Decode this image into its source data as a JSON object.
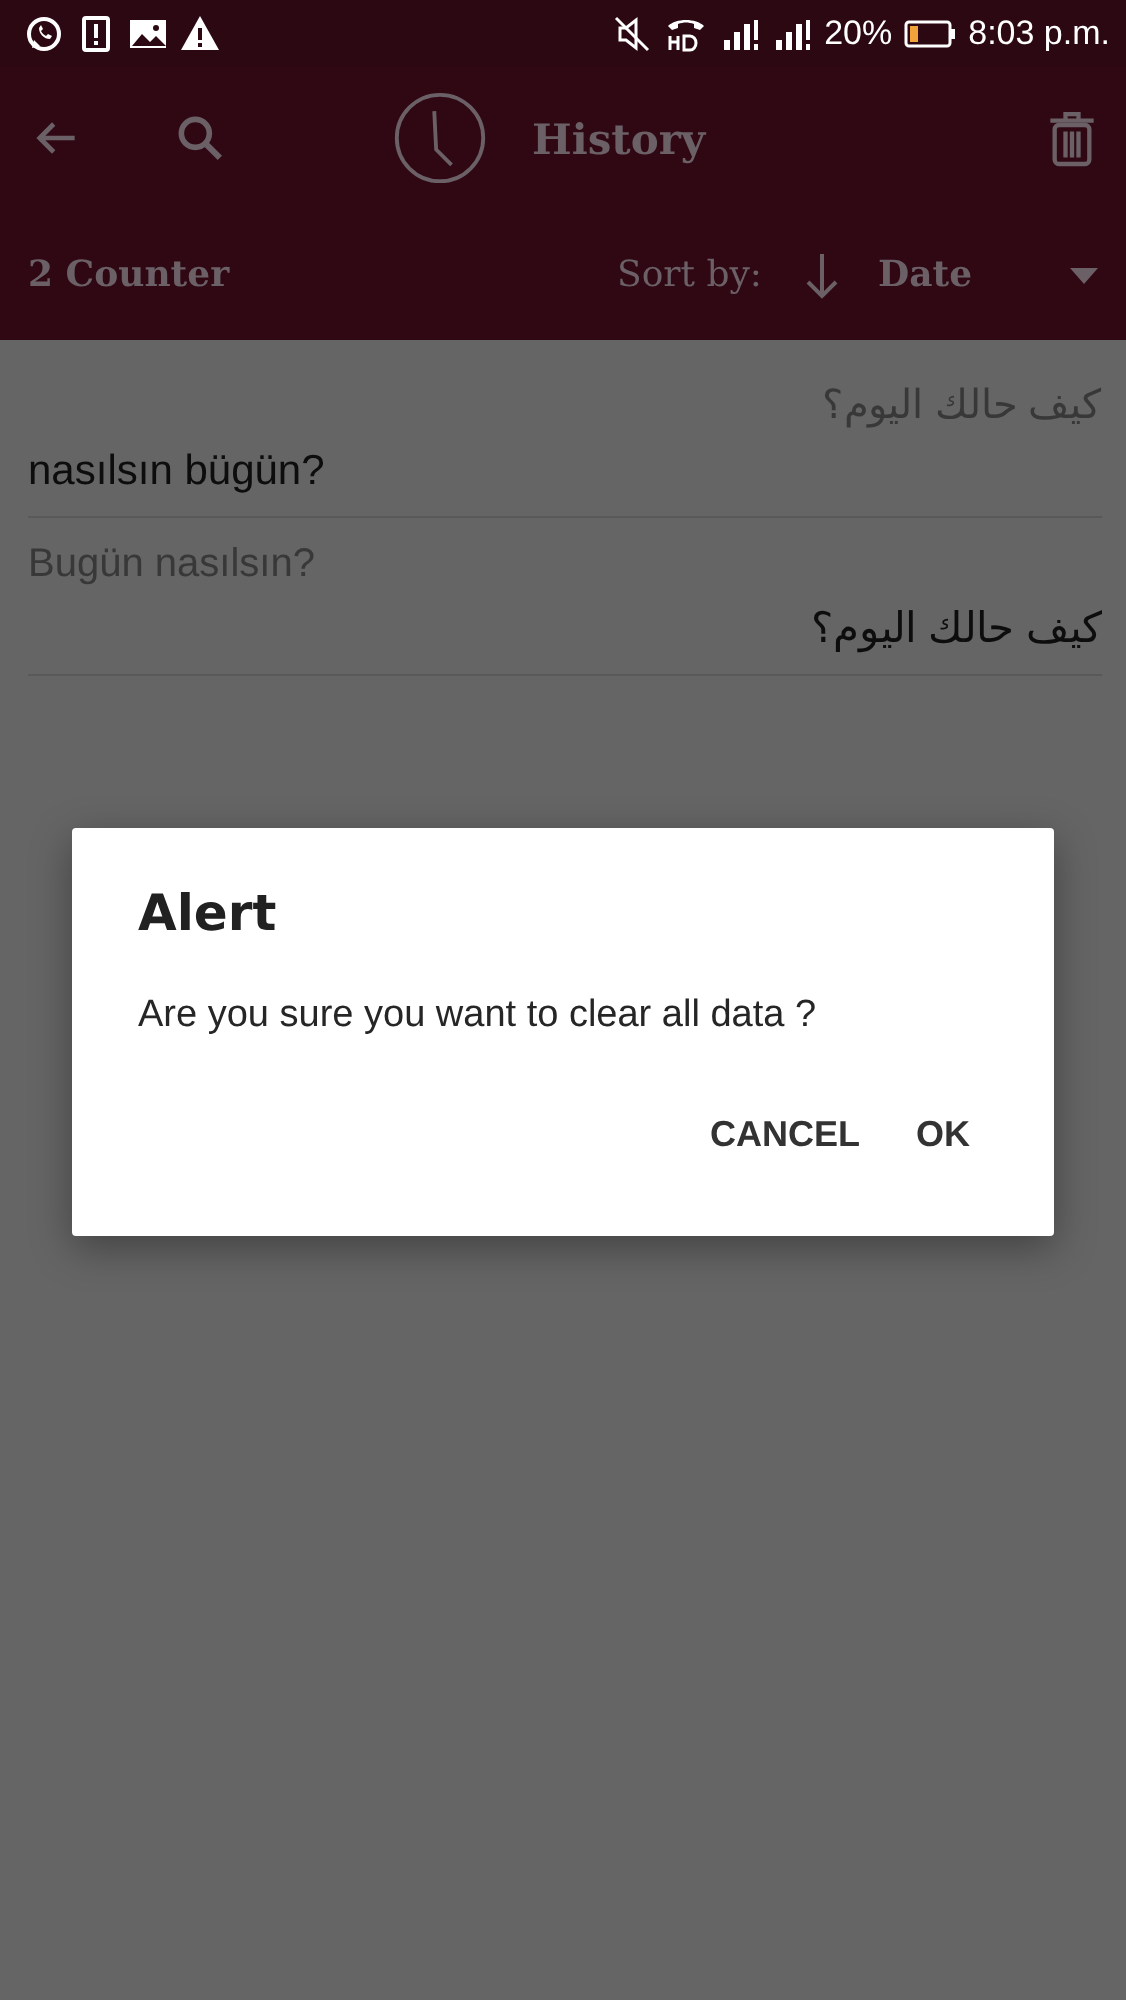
{
  "status_bar": {
    "battery": "20%",
    "time": "8:03 p.m."
  },
  "toolbar": {
    "title": "History"
  },
  "sort_bar": {
    "count": "2 Counter",
    "sort_label": "Sort by:",
    "sort_value": "Date"
  },
  "entries": [
    {
      "source": "كيف حالك اليوم؟",
      "translation": "nasılsın bügün?"
    },
    {
      "source": "Bugün nasılsın?",
      "translation": "كيف حالك اليوم؟"
    }
  ],
  "dialog": {
    "title": "Alert",
    "message": "Are you sure you want to clear all data ?",
    "buttons": [
      "CANCEL",
      "OK"
    ]
  }
}
